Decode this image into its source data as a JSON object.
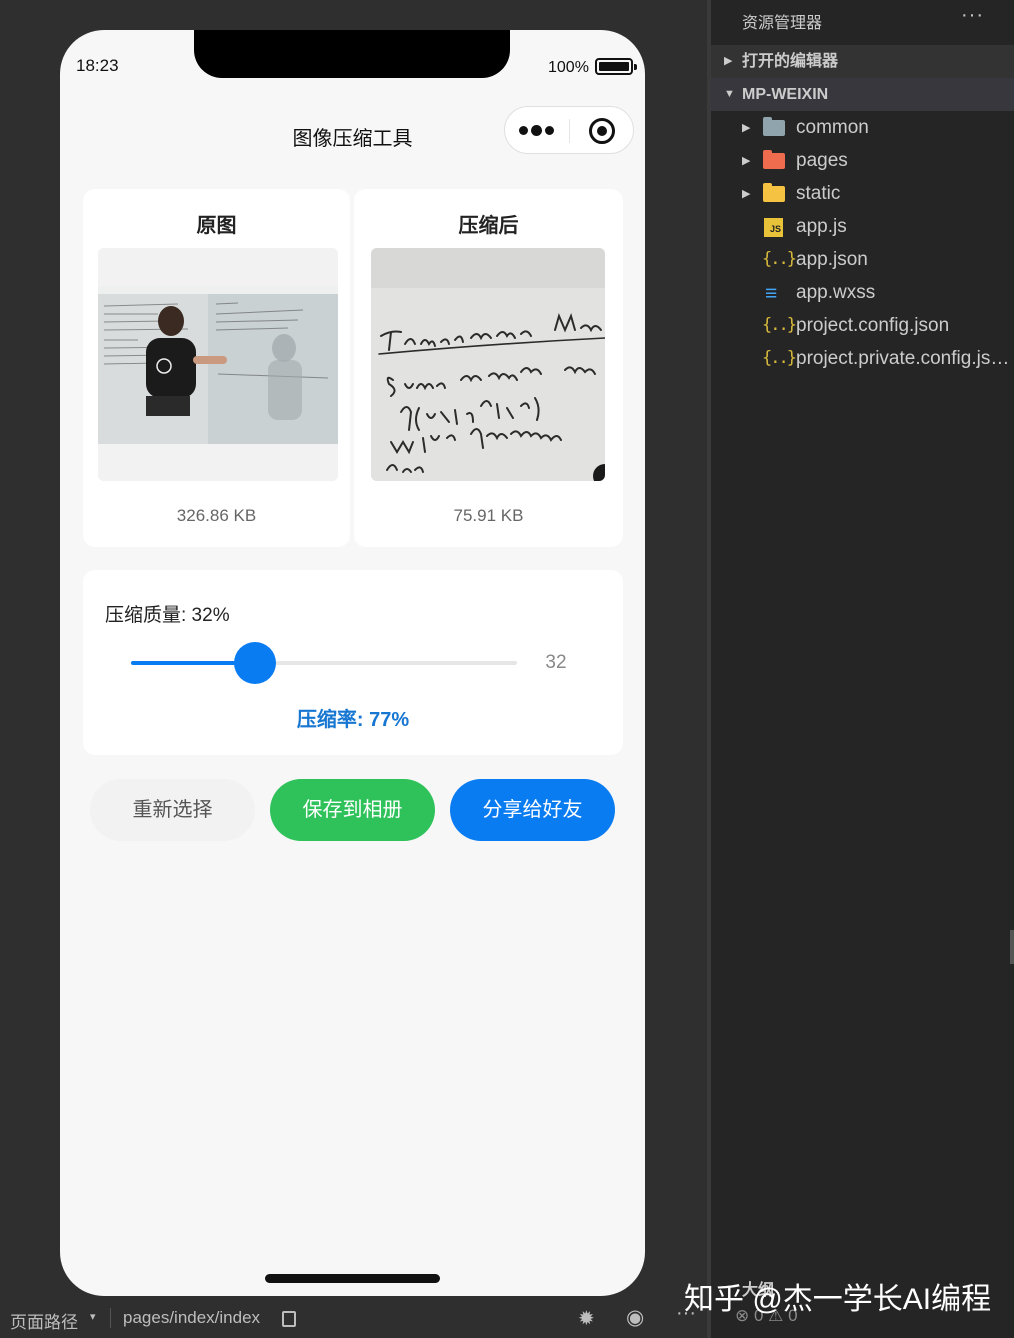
{
  "phone": {
    "time": "18:23",
    "battery": "100%",
    "title": "图像压缩工具"
  },
  "original": {
    "title": "原图",
    "size": "326.86 KB"
  },
  "compressed": {
    "title": "压缩后",
    "size": "75.91 KB"
  },
  "quality": {
    "label": "压缩质量: 32%",
    "value": 32,
    "value_text": "32",
    "ratio": "压缩率: 77%"
  },
  "buttons": {
    "reselect": "重新选择",
    "save": "保存到相册",
    "share": "分享给好友"
  },
  "explorer": {
    "title": "资源管理器",
    "more": "···",
    "open_editors": "打开的编辑器",
    "project": "MP-WEIXIN",
    "items": [
      {
        "name": "common",
        "icon": "folder-icon"
      },
      {
        "name": "pages",
        "icon": "folder-pages-icon"
      },
      {
        "name": "static",
        "icon": "folder-static-icon"
      },
      {
        "name": "app.js",
        "icon": "js-file-icon"
      },
      {
        "name": "app.json",
        "icon": "json-file-icon"
      },
      {
        "name": "app.wxss",
        "icon": "css-file-icon"
      },
      {
        "name": "project.config.json",
        "icon": "json-file-icon"
      },
      {
        "name": "project.private.config.json",
        "icon": "json-file-icon"
      }
    ],
    "outline": "大纲",
    "problems": "⊗ 0 ⚠ 0"
  },
  "bottom_bar": {
    "route_label": "页面路径",
    "route_caret": "▾",
    "path": "pages/index/index"
  },
  "watermark": "知乎 @杰一学长AI编程",
  "colors": {
    "accent_blue": "#0a7cf2",
    "save_green": "#2fc25b",
    "ratio_blue": "#1676d2"
  }
}
